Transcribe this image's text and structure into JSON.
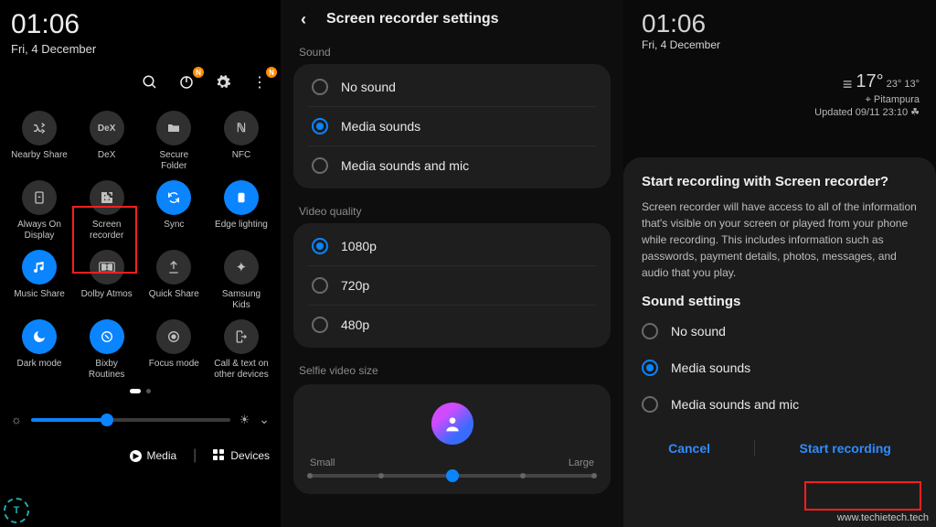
{
  "watermark": "www.techietech.tech",
  "panel1": {
    "clock": "01:06",
    "date": "Fri, 4 December",
    "topbar": {
      "search": "search-icon",
      "power": "power-icon",
      "settings": "gear-icon",
      "more": "more-icon"
    },
    "tiles": [
      [
        {
          "label": "Nearby Share",
          "icon": "shuffle",
          "on": false
        },
        {
          "label": "DeX",
          "icon": "dex",
          "on": false
        },
        {
          "label": "Secure Folder",
          "icon": "folder",
          "on": false
        },
        {
          "label": "NFC",
          "icon": "nfc",
          "on": false
        }
      ],
      [
        {
          "label": "Always On Display",
          "icon": "aod",
          "on": false
        },
        {
          "label": "Screen recorder",
          "icon": "rec",
          "on": false
        },
        {
          "label": "Sync",
          "icon": "sync",
          "on": true
        },
        {
          "label": "Edge lighting",
          "icon": "edge",
          "on": true
        }
      ],
      [
        {
          "label": "Music Share",
          "icon": "music",
          "on": true
        },
        {
          "label": "Dolby Atmos",
          "icon": "dolby",
          "on": false
        },
        {
          "label": "Quick Share",
          "icon": "quick",
          "on": false
        },
        {
          "label": "Samsung Kids",
          "icon": "kids",
          "on": false
        }
      ],
      [
        {
          "label": "Dark mode",
          "icon": "moon",
          "on": true
        },
        {
          "label": "Bixby Routines",
          "icon": "bixby",
          "on": true
        },
        {
          "label": "Focus mode",
          "icon": "focus",
          "on": false
        },
        {
          "label": "Call & text on other devices",
          "icon": "callext",
          "on": false
        }
      ]
    ],
    "brightness_pct": 38,
    "bottom": {
      "media": "Media",
      "devices": "Devices"
    }
  },
  "panel2": {
    "title": "Screen recorder settings",
    "sound_section": "Sound",
    "sound": [
      {
        "label": "No sound",
        "on": false
      },
      {
        "label": "Media sounds",
        "on": true
      },
      {
        "label": "Media sounds and mic",
        "on": false
      }
    ],
    "quality_section": "Video quality",
    "quality": [
      {
        "label": "1080p",
        "on": true
      },
      {
        "label": "720p",
        "on": false
      },
      {
        "label": "480p",
        "on": false
      }
    ],
    "selfie_section": "Selfie video size",
    "selfie": {
      "small": "Small",
      "large": "Large",
      "pos_pct": 50
    }
  },
  "panel3": {
    "clock": "01:06",
    "date": "Fri, 4 December",
    "weather": {
      "temp": "17°",
      "hilo": "23° 13°",
      "loc": "⌖ Pitampura",
      "updated": "Updated 09/11 23:10 ☘"
    },
    "dialog": {
      "title": "Start recording with Screen recorder?",
      "body": "Screen recorder will have access to all of the information that's visible on your screen or played from your phone while recording. This includes information such as passwords, payment details, photos, messages, and audio that you play.",
      "sound_heading": "Sound settings",
      "sound": [
        {
          "label": "No sound",
          "on": false
        },
        {
          "label": "Media sounds",
          "on": true
        },
        {
          "label": "Media sounds and mic",
          "on": false
        }
      ],
      "cancel": "Cancel",
      "start": "Start recording"
    }
  }
}
